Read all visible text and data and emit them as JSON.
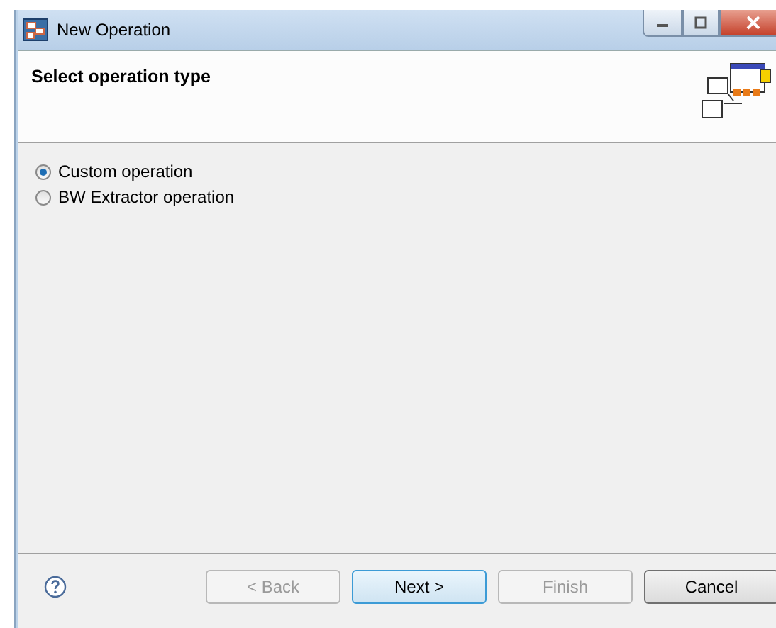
{
  "window": {
    "title": "New Operation"
  },
  "header": {
    "title": "Select operation type"
  },
  "options": [
    {
      "label": "Custom operation",
      "selected": true
    },
    {
      "label": "BW Extractor operation",
      "selected": false
    }
  ],
  "buttons": [
    {
      "label": "< Back",
      "disabled": true,
      "default": false
    },
    {
      "label": "Next >",
      "disabled": false,
      "default": true
    },
    {
      "label": "Finish",
      "disabled": true,
      "default": false
    },
    {
      "label": "Cancel",
      "disabled": false,
      "default": false
    }
  ]
}
